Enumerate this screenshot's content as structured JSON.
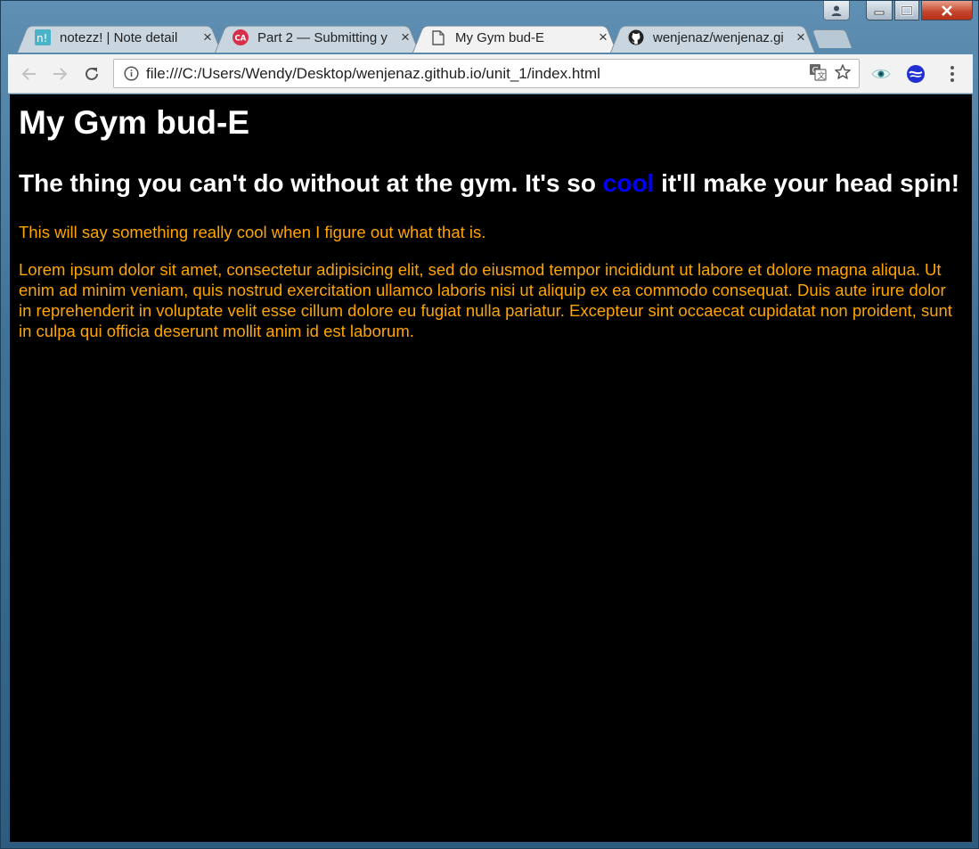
{
  "browser": {
    "tabs": [
      {
        "title": "notezz! | Note detail",
        "icon": "notezz-favicon",
        "active": false
      },
      {
        "title": "Part 2 — Submitting y",
        "icon": "codecademy-favicon",
        "active": false
      },
      {
        "title": "My Gym bud-E",
        "icon": "document-icon",
        "active": true
      },
      {
        "title": "wenjenaz/wenjenaz.gi",
        "icon": "github-icon",
        "active": false
      }
    ],
    "close_glyph": "×",
    "address_url": "file:///C:/Users/Wendy/Desktop/wenjenaz.github.io/unit_1/index.html"
  },
  "page": {
    "heading": "My Gym bud-E",
    "subheading_before": "The thing you can't do without at the gym. It's so ",
    "subheading_highlight": "cool",
    "subheading_after": " it'll make your head spin!",
    "tagline": "This will say something really cool when I figure out what that is.",
    "lorem": "Lorem ipsum dolor sit amet, consectetur adipisicing elit, sed do eiusmod tempor incididunt ut labore et dolore magna aliqua. Ut enim ad minim veniam, quis nostrud exercitation ullamco laboris nisi ut aliquip ex ea commodo consequat. Duis aute irure dolor in reprehenderit in voluptate velit esse cillum dolore eu fugiat nulla pariatur. Excepteur sint occaecat cupidatat non proident, sunt in culpa qui officia deserunt mollit anim id est laborum."
  },
  "colors": {
    "page_background": "#000000",
    "heading": "#ffffff",
    "highlight": "#0000ff",
    "body_text": "#ffa500"
  }
}
